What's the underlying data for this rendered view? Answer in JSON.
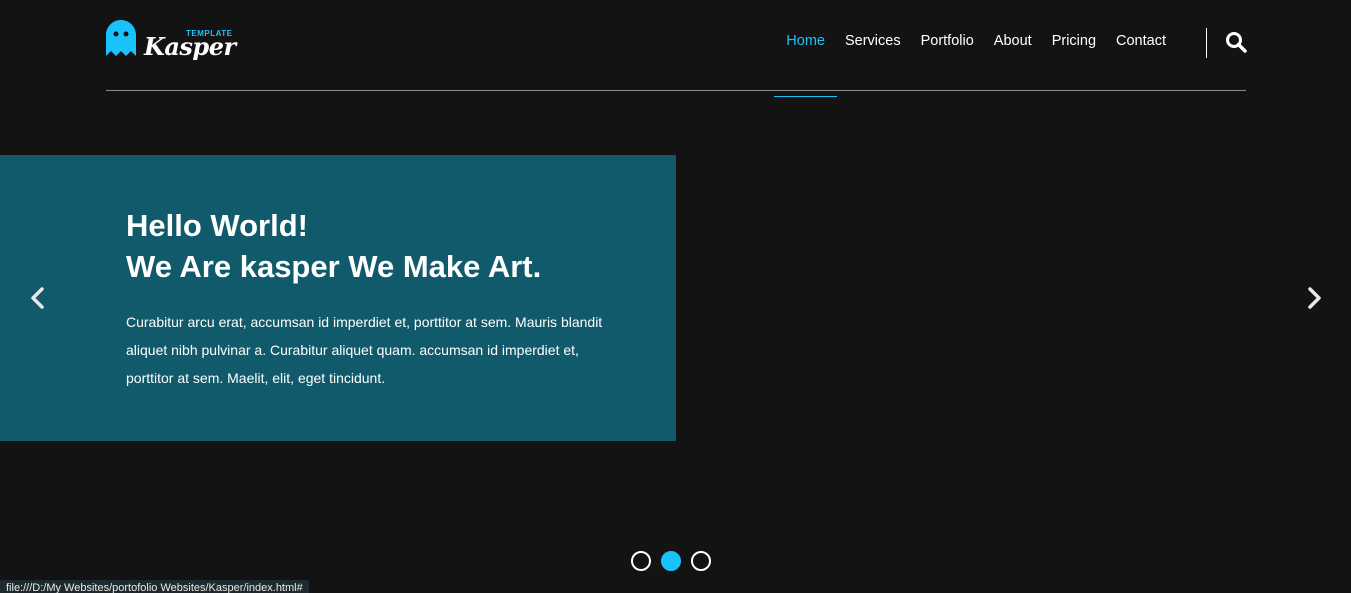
{
  "brand": {
    "small_text": "TEMPLATE",
    "name": "Kasper",
    "accent_color": "#19c2fa"
  },
  "nav": {
    "items": [
      {
        "label": "Home",
        "active": true
      },
      {
        "label": "Services",
        "active": false
      },
      {
        "label": "Portfolio",
        "active": false
      },
      {
        "label": "About",
        "active": false
      },
      {
        "label": "Pricing",
        "active": false
      },
      {
        "label": "Contact",
        "active": false
      }
    ],
    "search_icon": "search-icon"
  },
  "slider": {
    "title_line1": "Hello World!",
    "title_line2": "We Are kasper We Make Art.",
    "text": "Curabitur arcu erat, accumsan id imperdiet et, porttitor at sem. Mauris blandit aliquet nibh pulvinar a. Curabitur aliquet quam. accumsan id imperdiet et, porttitor at sem. Maelit, elit, eget tincidunt.",
    "box_color": "#105a6b",
    "prev_icon": "chevron-left-icon",
    "next_icon": "chevron-right-icon",
    "bullets_count": 3,
    "active_bullet": 2
  },
  "status_bar": {
    "url": "file:///D:/My Websites/portofolio Websites/Kasper/index.html#"
  }
}
